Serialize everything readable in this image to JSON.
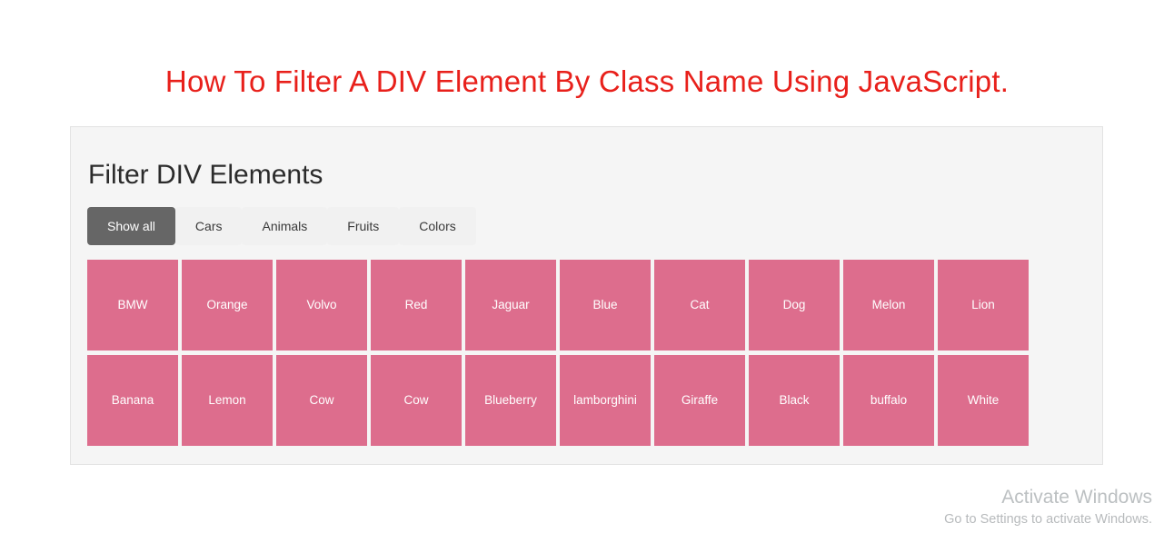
{
  "page": {
    "title": "How To Filter A DIV Element By Class Name Using JavaScript.",
    "title_color": "#e8201b",
    "background": "#ffffff"
  },
  "panel": {
    "heading": "Filter DIV Elements",
    "background": "#f5f5f5",
    "border_color": "#e3e3e3"
  },
  "filters": {
    "active_index": 0,
    "active_color": "#666666",
    "inactive_color": "#f1f1f1",
    "buttons": [
      {
        "label": "Show all",
        "active": true
      },
      {
        "label": "Cars",
        "active": false
      },
      {
        "label": "Animals",
        "active": false
      },
      {
        "label": "Fruits",
        "active": false
      },
      {
        "label": "Colors",
        "active": false
      }
    ]
  },
  "grid": {
    "tile_color": "#dd6d8d",
    "tile_text_color": "#ffffff",
    "columns": 10,
    "rows": 2,
    "items": [
      {
        "label": "BMW",
        "category": "cars"
      },
      {
        "label": "Orange",
        "category": "fruits"
      },
      {
        "label": "Volvo",
        "category": "cars"
      },
      {
        "label": "Red",
        "category": "colors"
      },
      {
        "label": "Jaguar",
        "category": "cars"
      },
      {
        "label": "Blue",
        "category": "colors"
      },
      {
        "label": "Cat",
        "category": "animals"
      },
      {
        "label": "Dog",
        "category": "animals"
      },
      {
        "label": "Melon",
        "category": "fruits"
      },
      {
        "label": "Lion",
        "category": "animals"
      },
      {
        "label": "Banana",
        "category": "fruits"
      },
      {
        "label": "Lemon",
        "category": "fruits"
      },
      {
        "label": "Cow",
        "category": "animals"
      },
      {
        "label": "Cow",
        "category": "animals"
      },
      {
        "label": "Blueberry",
        "category": "fruits"
      },
      {
        "label": "lamborghini",
        "category": "cars"
      },
      {
        "label": "Giraffe",
        "category": "animals"
      },
      {
        "label": "Black",
        "category": "colors"
      },
      {
        "label": "buffalo",
        "category": "animals"
      },
      {
        "label": "White",
        "category": "colors"
      }
    ]
  },
  "watermark": {
    "title": "Activate Windows",
    "subtitle": "Go to Settings to activate Windows."
  }
}
